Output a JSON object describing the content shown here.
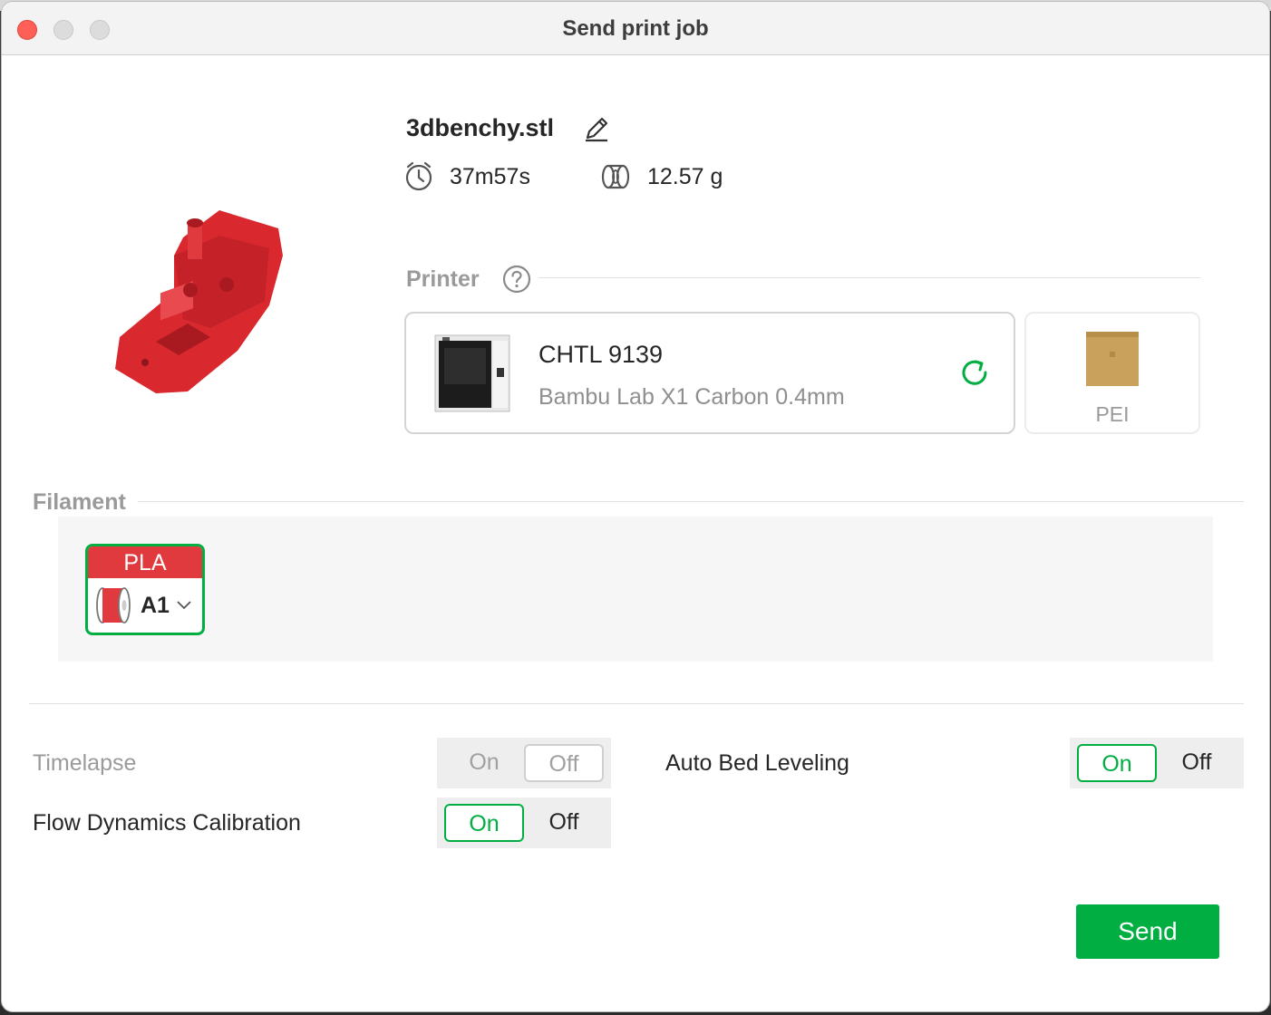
{
  "window": {
    "title": "Send print job"
  },
  "file": {
    "name": "3dbenchy.stl",
    "print_time": "37m57s",
    "weight": "12.57 g"
  },
  "printer": {
    "section_label": "Printer",
    "name": "CHTL 9139",
    "model": "Bambu Lab X1 Carbon  0.4mm",
    "plate_label": "PEI"
  },
  "filament": {
    "section_label": "Filament",
    "items": [
      {
        "type": "PLA",
        "slot": "A1",
        "color": "#e03a3e"
      }
    ]
  },
  "options": {
    "timelapse": {
      "label": "Timelapse",
      "on": "On",
      "off": "Off",
      "selected": "off",
      "enabled": false
    },
    "flow_dynamics": {
      "label": "Flow Dynamics Calibration",
      "on": "On",
      "off": "Off",
      "selected": "on",
      "enabled": true
    },
    "auto_bed_leveling": {
      "label": "Auto Bed Leveling",
      "on": "On",
      "off": "Off",
      "selected": "on",
      "enabled": true
    }
  },
  "actions": {
    "send_label": "Send"
  },
  "colors": {
    "accent": "#00ae42",
    "filament_red": "#e03a3e",
    "plate_gold": "#c9a15c"
  },
  "icons": [
    "close-icon",
    "minimize-icon",
    "maximize-icon",
    "edit-icon",
    "clock-icon",
    "filament-weight-icon",
    "help-icon",
    "refresh-icon",
    "spool-icon",
    "chevron-down-icon"
  ]
}
